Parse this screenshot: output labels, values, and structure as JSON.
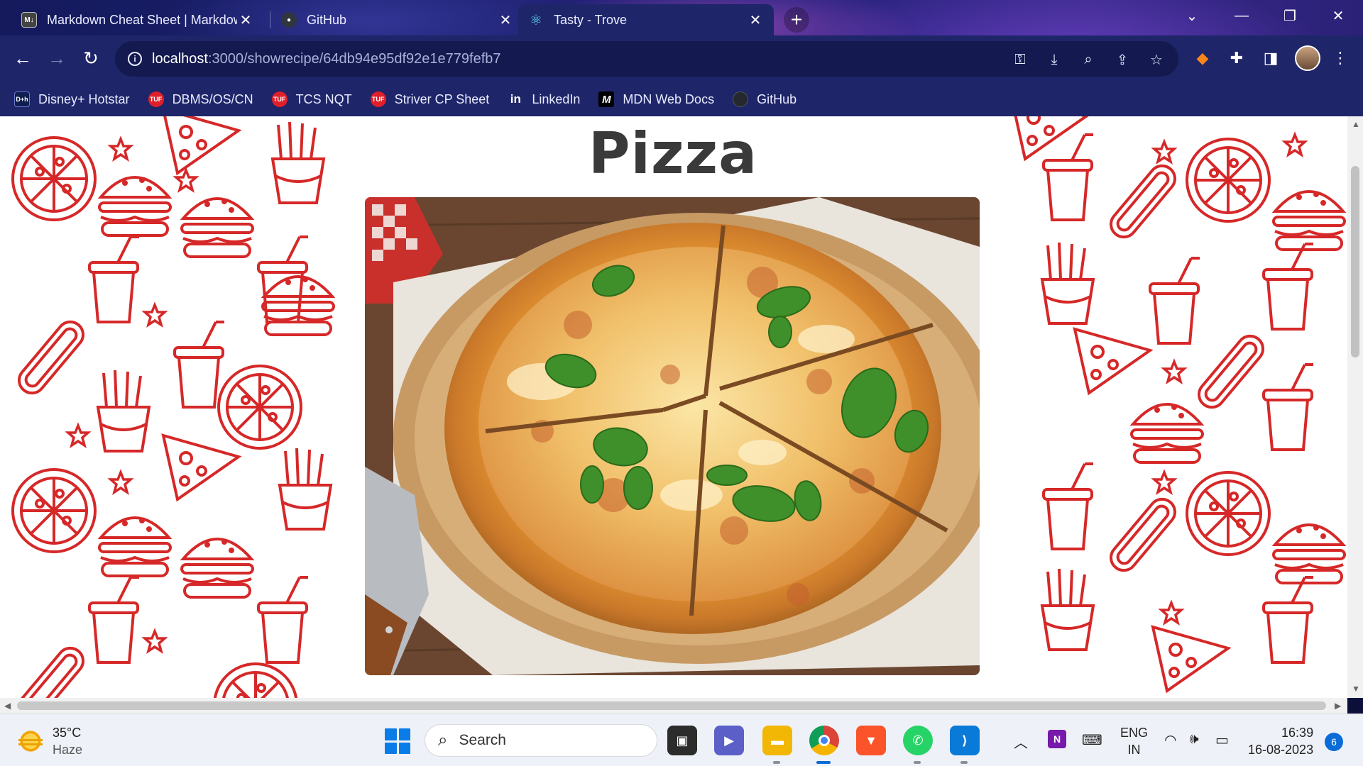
{
  "browser": {
    "tabs": [
      {
        "title": "Markdown Cheat Sheet | Markdown Guide",
        "favicon": "markdown-icon",
        "active": false
      },
      {
        "title": "GitHub",
        "favicon": "github-icon",
        "active": false
      },
      {
        "title": "Tasty - Trove",
        "favicon": "react-icon",
        "active": true
      }
    ],
    "new_tab_label": "+",
    "url": {
      "host": "localhost",
      "path": ":3000/showrecipe/64db94e95df92e1e779fefb7"
    },
    "bookmarks": [
      {
        "label": "Disney+ Hotstar",
        "icon": "hotstar-icon",
        "color": "#0f1d4f",
        "badge": "D+h"
      },
      {
        "label": "DBMS/OS/CN",
        "icon": "tuf-icon",
        "color": "#e01f2b",
        "badge": "TUF"
      },
      {
        "label": "TCS NQT",
        "icon": "tuf-icon",
        "color": "#e01f2b",
        "badge": "TUF"
      },
      {
        "label": "Striver CP Sheet",
        "icon": "tuf-icon",
        "color": "#e01f2b",
        "badge": "TUF"
      },
      {
        "label": "LinkedIn",
        "icon": "linkedin-icon",
        "color": "#1e2568",
        "badge": "in"
      },
      {
        "label": "MDN Web Docs",
        "icon": "mdn-icon",
        "color": "#000000",
        "badge": "M"
      },
      {
        "label": "GitHub",
        "icon": "github-icon",
        "color": "#24292f",
        "badge": ""
      }
    ]
  },
  "page": {
    "recipe_title": "Pizza",
    "image_subject": "margherita-pizza-photo",
    "pattern_color": "#d62828"
  },
  "taskbar": {
    "weather": {
      "temp": "35°C",
      "condition": "Haze"
    },
    "search_placeholder": "Search",
    "language": {
      "line1": "ENG",
      "line2": "IN"
    },
    "time": "16:39",
    "date": "16-08-2023",
    "notification_count": "6"
  }
}
